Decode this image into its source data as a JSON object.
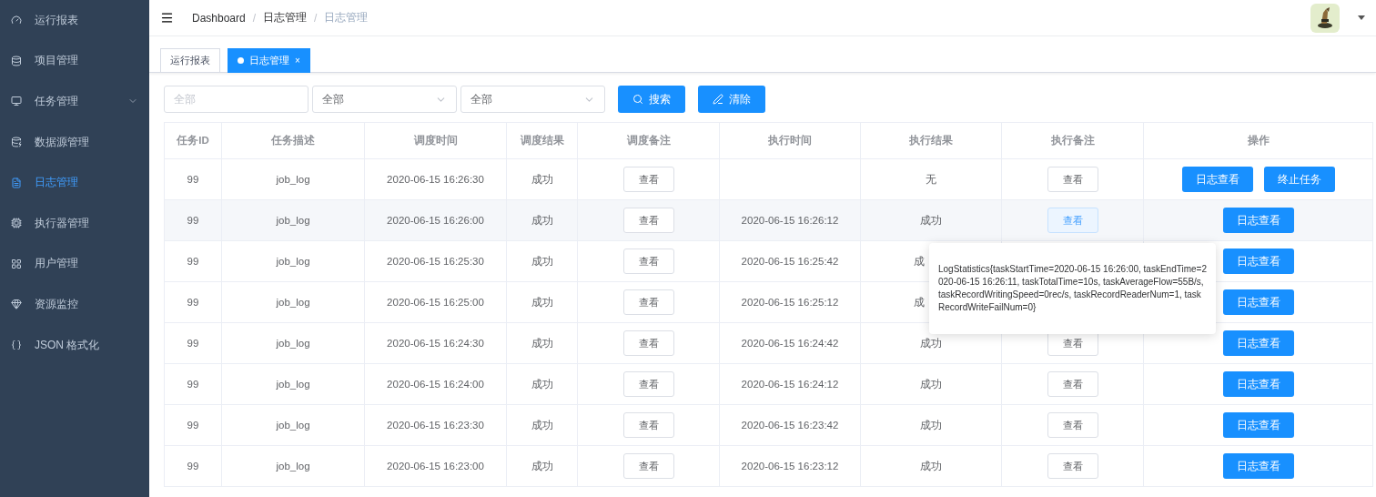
{
  "sidebar": {
    "items": [
      {
        "label": "运行报表",
        "selected": false,
        "expandable": false
      },
      {
        "label": "项目管理",
        "selected": false,
        "expandable": false
      },
      {
        "label": "任务管理",
        "selected": false,
        "expandable": true
      },
      {
        "label": "数据源管理",
        "selected": false,
        "expandable": false
      },
      {
        "label": "日志管理",
        "selected": true,
        "expandable": false
      },
      {
        "label": "执行器管理",
        "selected": false,
        "expandable": false
      },
      {
        "label": "用户管理",
        "selected": false,
        "expandable": false
      },
      {
        "label": "资源监控",
        "selected": false,
        "expandable": false
      },
      {
        "label": "JSON 格式化",
        "selected": false,
        "expandable": false
      }
    ]
  },
  "breadcrumb": {
    "separator": "/",
    "items": [
      "Dashboard",
      "日志管理",
      "日志管理"
    ]
  },
  "tabs": [
    {
      "label": "运行报表",
      "selected": false
    },
    {
      "label": "日志管理",
      "selected": true,
      "close": "×"
    }
  ],
  "filters": {
    "fields": [
      {
        "kind": "input",
        "placeholder": "全部"
      },
      {
        "kind": "select",
        "value": "全部"
      },
      {
        "kind": "select",
        "value": "全部"
      }
    ],
    "buttons": [
      {
        "kind": "search",
        "label": "搜索"
      },
      {
        "kind": "clear",
        "label": "清除"
      }
    ]
  },
  "table": {
    "columns": [
      "任务ID",
      "任务描述",
      "调度时间",
      "调度结果",
      "调度备注",
      "执行时间",
      "执行结果",
      "执行备注",
      "操作"
    ],
    "rows": [
      {
        "id": "99",
        "desc": "job_log",
        "trigger_time": "2020-06-15 16:26:30",
        "trigger_result": "成功",
        "trigger_note": "查看",
        "exec_time": "",
        "exec_result": "无",
        "exec_note": "查看",
        "actions": [
          "日志查看",
          "终止任务"
        ]
      },
      {
        "id": "99",
        "desc": "job_log",
        "trigger_time": "2020-06-15 16:26:00",
        "trigger_result": "成功",
        "trigger_note": "查看",
        "exec_time": "2020-06-15 16:26:12",
        "exec_result": "成功",
        "exec_note": "查看",
        "exec_note_hover": true,
        "tooltip": "LogStatistics{taskStartTime=2020-06-15 16:26:00, taskEndTime=2020-06-15 16:26:11, taskTotalTime=10s, taskAverageFlow=55B/s, taskRecordWritingSpeed=0rec/s, taskRecordReaderNum=1, taskRecordWriteFailNum=0}",
        "actions": [
          "日志查看"
        ]
      },
      {
        "id": "99",
        "desc": "job_log",
        "trigger_time": "2020-06-15 16:25:30",
        "trigger_result": "成功",
        "trigger_note": "查看",
        "exec_time": "2020-06-15 16:25:42",
        "exec_result": "成",
        "covered": true,
        "actions": [
          "日志查看"
        ]
      },
      {
        "id": "99",
        "desc": "job_log",
        "trigger_time": "2020-06-15 16:25:00",
        "trigger_result": "成功",
        "trigger_note": "查看",
        "exec_time": "2020-06-15 16:25:12",
        "exec_result": "成",
        "covered": true,
        "actions": [
          "日志查看"
        ]
      },
      {
        "id": "99",
        "desc": "job_log",
        "trigger_time": "2020-06-15 16:24:30",
        "trigger_result": "成功",
        "trigger_note": "查看",
        "exec_time": "2020-06-15 16:24:42",
        "exec_result": "成功",
        "exec_note": "查看",
        "actions": [
          "日志查看"
        ]
      },
      {
        "id": "99",
        "desc": "job_log",
        "trigger_time": "2020-06-15 16:24:00",
        "trigger_result": "成功",
        "trigger_note": "查看",
        "exec_time": "2020-06-15 16:24:12",
        "exec_result": "成功",
        "exec_note": "查看",
        "actions": [
          "日志查看"
        ]
      },
      {
        "id": "99",
        "desc": "job_log",
        "trigger_time": "2020-06-15 16:23:30",
        "trigger_result": "成功",
        "trigger_note": "查看",
        "exec_time": "2020-06-15 16:23:42",
        "exec_result": "成功",
        "exec_note": "查看",
        "actions": [
          "日志查看"
        ]
      },
      {
        "id": "99",
        "desc": "job_log",
        "trigger_time": "2020-06-15 16:23:00",
        "trigger_result": "成功",
        "trigger_note": "查看",
        "exec_time": "2020-06-15 16:23:12",
        "exec_result": "成功",
        "exec_note": "查看",
        "actions": [
          "日志查看"
        ]
      }
    ]
  }
}
